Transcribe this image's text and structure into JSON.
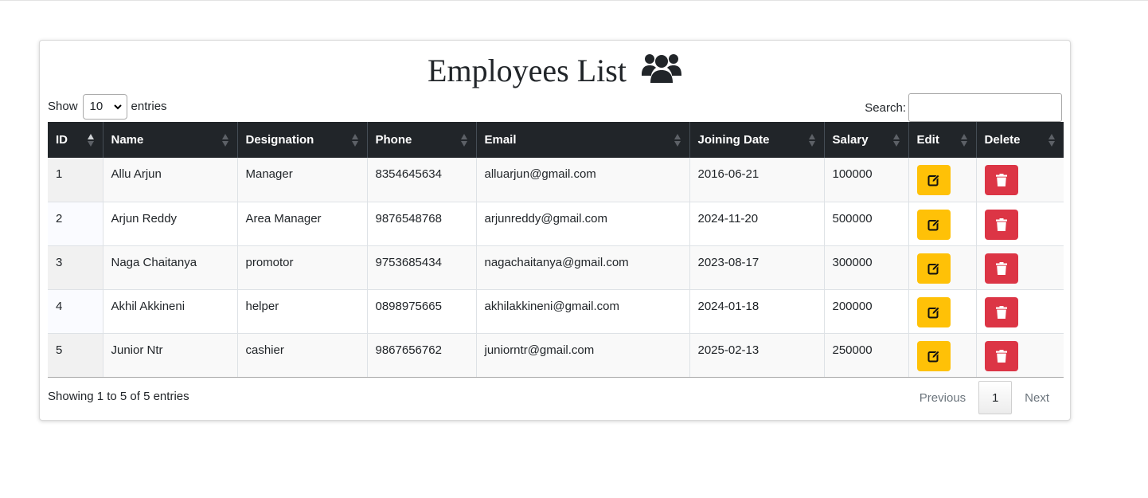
{
  "title": "Employees List",
  "title_icon": "users-icon",
  "length_control": {
    "show_label": "Show",
    "selected": "10",
    "entries_label": "entries"
  },
  "search": {
    "label": "Search:",
    "value": ""
  },
  "table": {
    "columns": [
      "ID",
      "Name",
      "Designation",
      "Phone",
      "Email",
      "Joining Date",
      "Salary",
      "Edit",
      "Delete"
    ],
    "sorted_column": "ID",
    "sort_direction": "ascending",
    "rows": [
      {
        "id": "1",
        "name": "Allu Arjun",
        "designation": "Manager",
        "phone": "8354645634",
        "email": "alluarjun@gmail.com",
        "joining_date": "2016-06-21",
        "salary": "100000"
      },
      {
        "id": "2",
        "name": "Arjun Reddy",
        "designation": "Area Manager",
        "phone": "9876548768",
        "email": "arjunreddy@gmail.com",
        "joining_date": "2024-11-20",
        "salary": "500000"
      },
      {
        "id": "3",
        "name": "Naga Chaitanya",
        "designation": "promotor",
        "phone": "9753685434",
        "email": "nagachaitanya@gmail.com",
        "joining_date": "2023-08-17",
        "salary": "300000"
      },
      {
        "id": "4",
        "name": "Akhil Akkineni",
        "designation": "helper",
        "phone": "0898975665",
        "email": "akhilakkineni@gmail.com",
        "joining_date": "2024-01-18",
        "salary": "200000"
      },
      {
        "id": "5",
        "name": "Junior Ntr",
        "designation": "cashier",
        "phone": "9867656762",
        "email": "juniorntr@gmail.com",
        "joining_date": "2025-02-13",
        "salary": "250000"
      }
    ]
  },
  "footer": {
    "info": "Showing 1 to 5 of 5 entries",
    "previous_label": "Previous",
    "current_page": "1",
    "next_label": "Next"
  },
  "colors": {
    "header_bg": "#212529",
    "edit_button": "#ffc107",
    "delete_button": "#dc3545"
  },
  "icons": {
    "edit": "edit-icon",
    "delete": "trash-icon",
    "sort": "sort-icon"
  }
}
